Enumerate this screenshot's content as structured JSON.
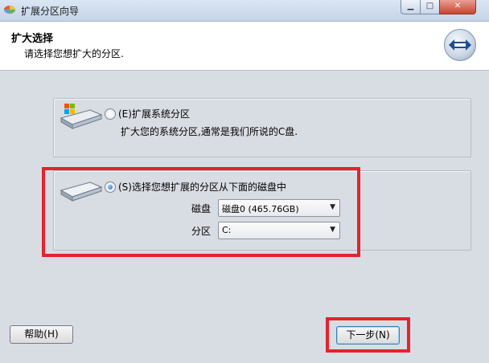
{
  "window": {
    "title": "扩展分区向导"
  },
  "header": {
    "title": "扩大选择",
    "subtitle": "请选择您想扩大的分区."
  },
  "option_system": {
    "label": "(E)扩展系统分区",
    "description": "扩大您的系统分区,通常是我们所说的C盘.",
    "selected": false
  },
  "option_custom": {
    "label": "(S)选择您想扩展的分区从下面的磁盘中",
    "selected": true,
    "disk_label": "磁盘",
    "disk_value": "磁盘0 (465.76GB)",
    "partition_label": "分区",
    "partition_value": "C:"
  },
  "buttons": {
    "help": "帮助(H)",
    "next": "下一步(N)"
  },
  "colors": {
    "highlight": "#e4232c",
    "dialog_bg": "#d8dde4"
  },
  "icons": {
    "app": "app-icon",
    "logo": "partition-wizard-logo",
    "system_drive": "system-drive-icon",
    "drive": "hard-drive-icon"
  }
}
